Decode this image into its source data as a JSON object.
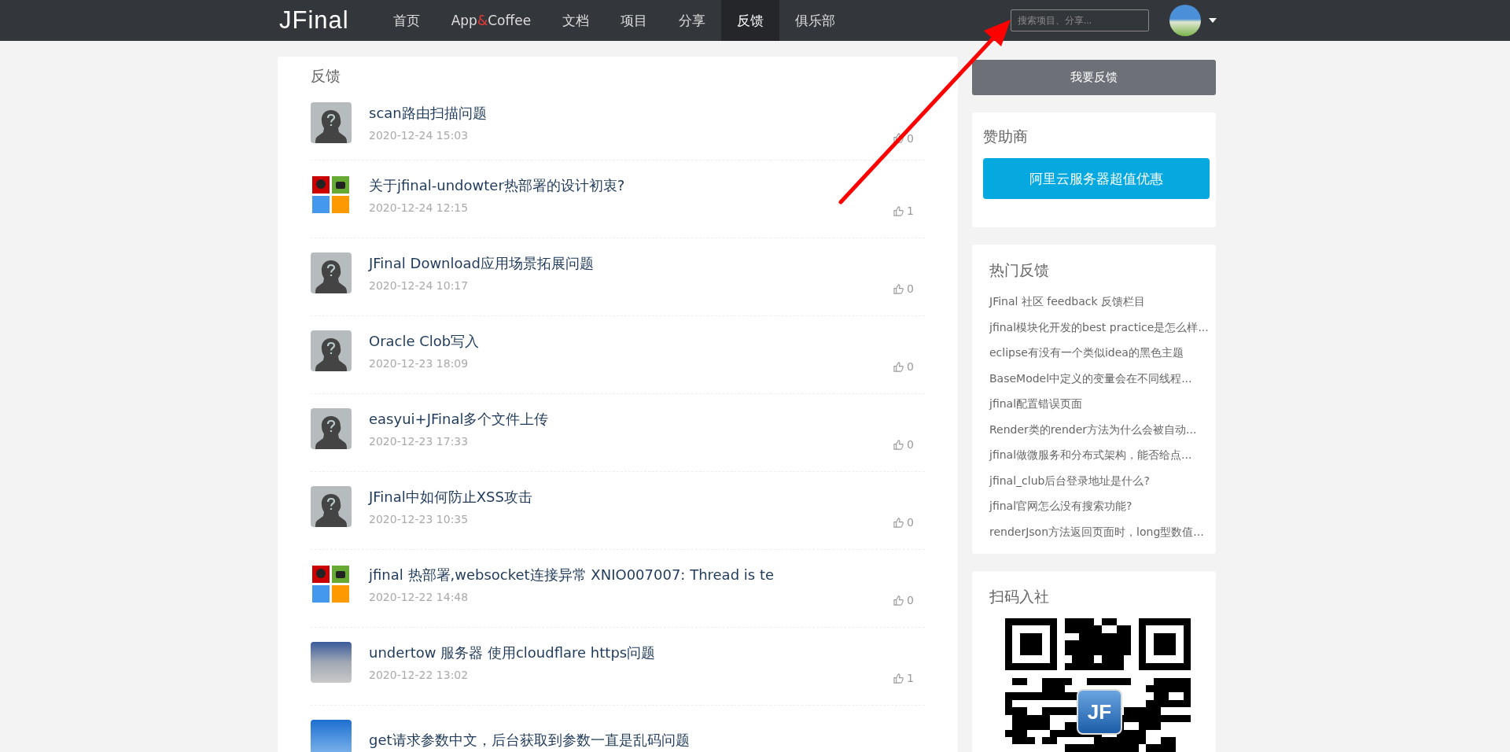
{
  "header": {
    "logo": "JFinal",
    "nav": [
      {
        "label": "首页",
        "selected": false
      },
      {
        "label": "App",
        "accent": "&",
        "label_end": "Coffee",
        "selected": false
      },
      {
        "label": "文档",
        "selected": false
      },
      {
        "label": "项目",
        "selected": false
      },
      {
        "label": "分享",
        "selected": false
      },
      {
        "label": "反馈",
        "selected": true
      },
      {
        "label": "俱乐部",
        "selected": false
      }
    ],
    "search": {
      "placeholder": "搜索项目、分享..."
    }
  },
  "feed": {
    "title": "反馈",
    "items": [
      {
        "kind": "default",
        "title": "scan路由扫描问题",
        "time": "2020-12-24 15:03",
        "likes": "0"
      },
      {
        "kind": "tiles",
        "title": "关于jfinal-undowter热部署的设计初衷?",
        "time": "2020-12-24 12:15",
        "likes": "1"
      },
      {
        "kind": "default",
        "title": "JFinal Download应用场景拓展问题",
        "time": "2020-12-24 10:17",
        "likes": "0"
      },
      {
        "kind": "default",
        "title": "Oracle Clob写入",
        "time": "2020-12-23 18:09",
        "likes": "0"
      },
      {
        "kind": "default",
        "title": "easyui+JFinal多个文件上传",
        "time": "2020-12-23 17:33",
        "likes": "0"
      },
      {
        "kind": "default",
        "title": "JFinal中如何防止XSS攻击",
        "time": "2020-12-23 10:35",
        "likes": "0"
      },
      {
        "kind": "tiles",
        "title": "jfinal 热部署,websocket连接异常 XNIO007007: Thread is te",
        "time": "2020-12-22 14:48",
        "likes": "0"
      },
      {
        "kind": "photo",
        "title": "undertow 服务器 使用cloudflare https问题",
        "time": "2020-12-22 13:02",
        "likes": "1"
      },
      {
        "kind": "sky",
        "title": "get请求参数中文，后台获取到参数一直是乱码问题"
      }
    ]
  },
  "sidebar": {
    "feedback_button": "我要反馈",
    "sponsor": {
      "title": "赞助商",
      "button": "阿里云服务器超值优惠"
    },
    "hot": {
      "title": "热门反馈",
      "links": [
        "JFinal 社区 feedback 反馈栏目",
        "jfinal模块化开发的best practice是怎么样...",
        "eclipse有没有一个类似idea的黑色主题",
        "BaseModel中定义的变量会在不同线程...",
        "jfinal配置错误页面",
        "Render类的render方法为什么会被自动...",
        "jfinal做微服务和分布式架构，能否给点...",
        "jfinal_club后台登录地址是什么?",
        "jfinal官网怎么没有搜索功能?",
        "renderJson方法返回页面时，long型数值..."
      ]
    },
    "qr": {
      "title": "扫码入社",
      "badge": "JF"
    }
  }
}
